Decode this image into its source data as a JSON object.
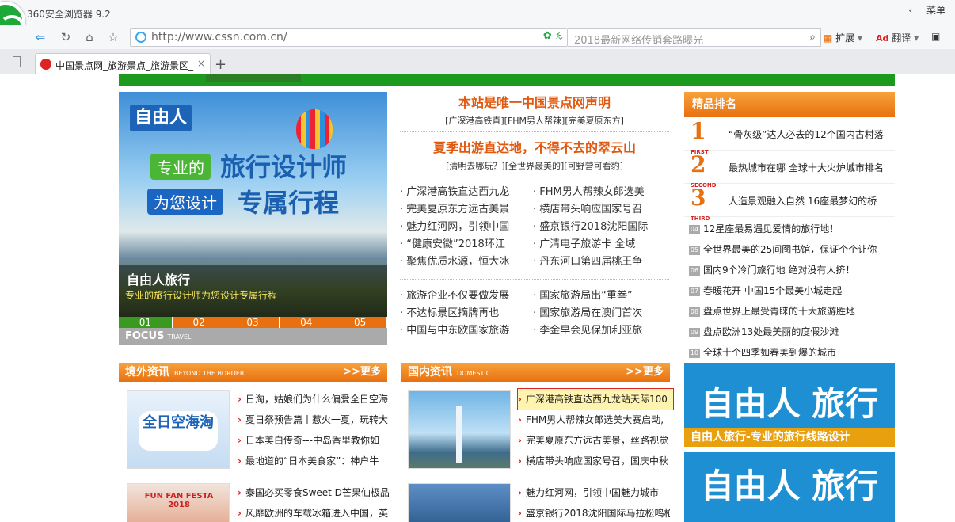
{
  "browser": {
    "app_title": "360安全浏览器 9.2",
    "menu_label": "菜单",
    "menu_chevron": "‹",
    "url": "http://www.cssn.com.cn/",
    "search_placeholder": "2018最新网络传销套路曝光",
    "ext_label": "扩展",
    "translate_label": "翻译",
    "tab_title": "中国景点网_旅游景点_旅游景区_",
    "tab_close": "×",
    "tab_add": "+"
  },
  "slideshow": {
    "badge": "自由人",
    "tag1": "专业的",
    "big1": "旅行设计师",
    "tag2": "为您设计",
    "big2": "专属行程",
    "caption_title": "自由人旅行",
    "caption_sub": "专业的旅行设计师为您设计专属行程",
    "pages": [
      "01",
      "02",
      "03",
      "04",
      "05"
    ],
    "focus_label": "FOCUS",
    "focus_sub": "TRAVEL"
  },
  "middle": {
    "headline1": "本站是唯一中国景点网声明",
    "sublinks1": "[广深港高铁直][FHM男人帮辣][完美夏原东方]",
    "headline2": "夏季出游直达地，不得不去的翠云山",
    "sublinks2": "[清明去哪玩？][全世界最美的][可野营可看豹]",
    "list1": [
      [
        "· 广深港高铁直达西九龙",
        "· FHM男人帮辣女郎选美"
      ],
      [
        "· 完美夏原东方远古美景",
        "· 横店带头响应国家号召"
      ],
      [
        "· 魅力红河网，引领中国",
        "· 盛京银行2018沈阳国际"
      ],
      [
        "· “健康安徽”2018环江",
        "· 广清电子旅游卡 全域"
      ],
      [
        "· 聚焦优质水源，恒大冰",
        "· 丹东河口第四届桃王争"
      ]
    ],
    "list2": [
      [
        "· 旅游企业不仅要做发展",
        "· 国家旅游局出“重拳”"
      ],
      [
        "· 不达标景区摘牌再也",
        "· 国家旅游局在澳门首次"
      ],
      [
        "· 中国与中东欧国家旅游",
        "· 李金早会见保加利亚旅"
      ]
    ]
  },
  "ranking": {
    "title": "精品排名",
    "top": [
      {
        "num": "1",
        "label": "FIRST",
        "text": "“骨灰级”达人必去的12个国内古村落"
      },
      {
        "num": "2",
        "label": "SECOND",
        "text": "最热城市在哪 全球十大火炉城市排名"
      },
      {
        "num": "3",
        "label": "THIRD",
        "text": "人造景观融入自然 16座最梦幻的桥"
      }
    ],
    "rest": [
      {
        "n": "04",
        "text": "12星座最易遇见爱情的旅行地！"
      },
      {
        "n": "05",
        "text": "全世界最美的25间图书馆，保证个个让你"
      },
      {
        "n": "06",
        "text": "国内9个冷门旅行地 绝对没有人挤！"
      },
      {
        "n": "07",
        "text": "春暖花开 中国15个最美小城走起"
      },
      {
        "n": "08",
        "text": "盘点世界上最受青睐的十大旅游胜地"
      },
      {
        "n": "09",
        "text": "盘点欧洲13处最美丽的度假沙滩"
      },
      {
        "n": "10",
        "text": "全球十个四季如春美到爆的城市"
      }
    ]
  },
  "abroad": {
    "title": "境外资讯",
    "subtitle": "BEYOND THE BORDER",
    "more": ">>更多",
    "thumb1_label": "全日空海淘",
    "thumb2_label": "FUN FAN FESTA 2018",
    "rows1": [
      "日淘，姑娘们为什么偏爱全日空海",
      "夏日祭预告篇丨惹火一夏，玩转大",
      "日本美白传奇---中岛香里教你如",
      "最地道的“日本美食家”：神户牛"
    ],
    "rows2": [
      "泰国必买零食Sweet D芒果仙极品",
      "风靡欧洲的车载冰箱进入中国，英"
    ]
  },
  "domestic": {
    "title": "国内资讯",
    "subtitle": "DOMESTIC",
    "more": ">>更多",
    "rows1": [
      "广深港高铁直达西九龙站天际100",
      "FHM男人帮辣女郎选美大赛启动,",
      "完美夏原东方远古美景，丝路视觉",
      "横店带头响应国家号召，国庆中秋"
    ],
    "rows2": [
      "魅力红河网，引领中国魅力城市",
      "盛京银行2018沈阳国际马拉松鸣枪"
    ]
  },
  "ads": {
    "big": "自由人 旅行",
    "strip": "自由人旅行-专业的旅行线路设计"
  }
}
